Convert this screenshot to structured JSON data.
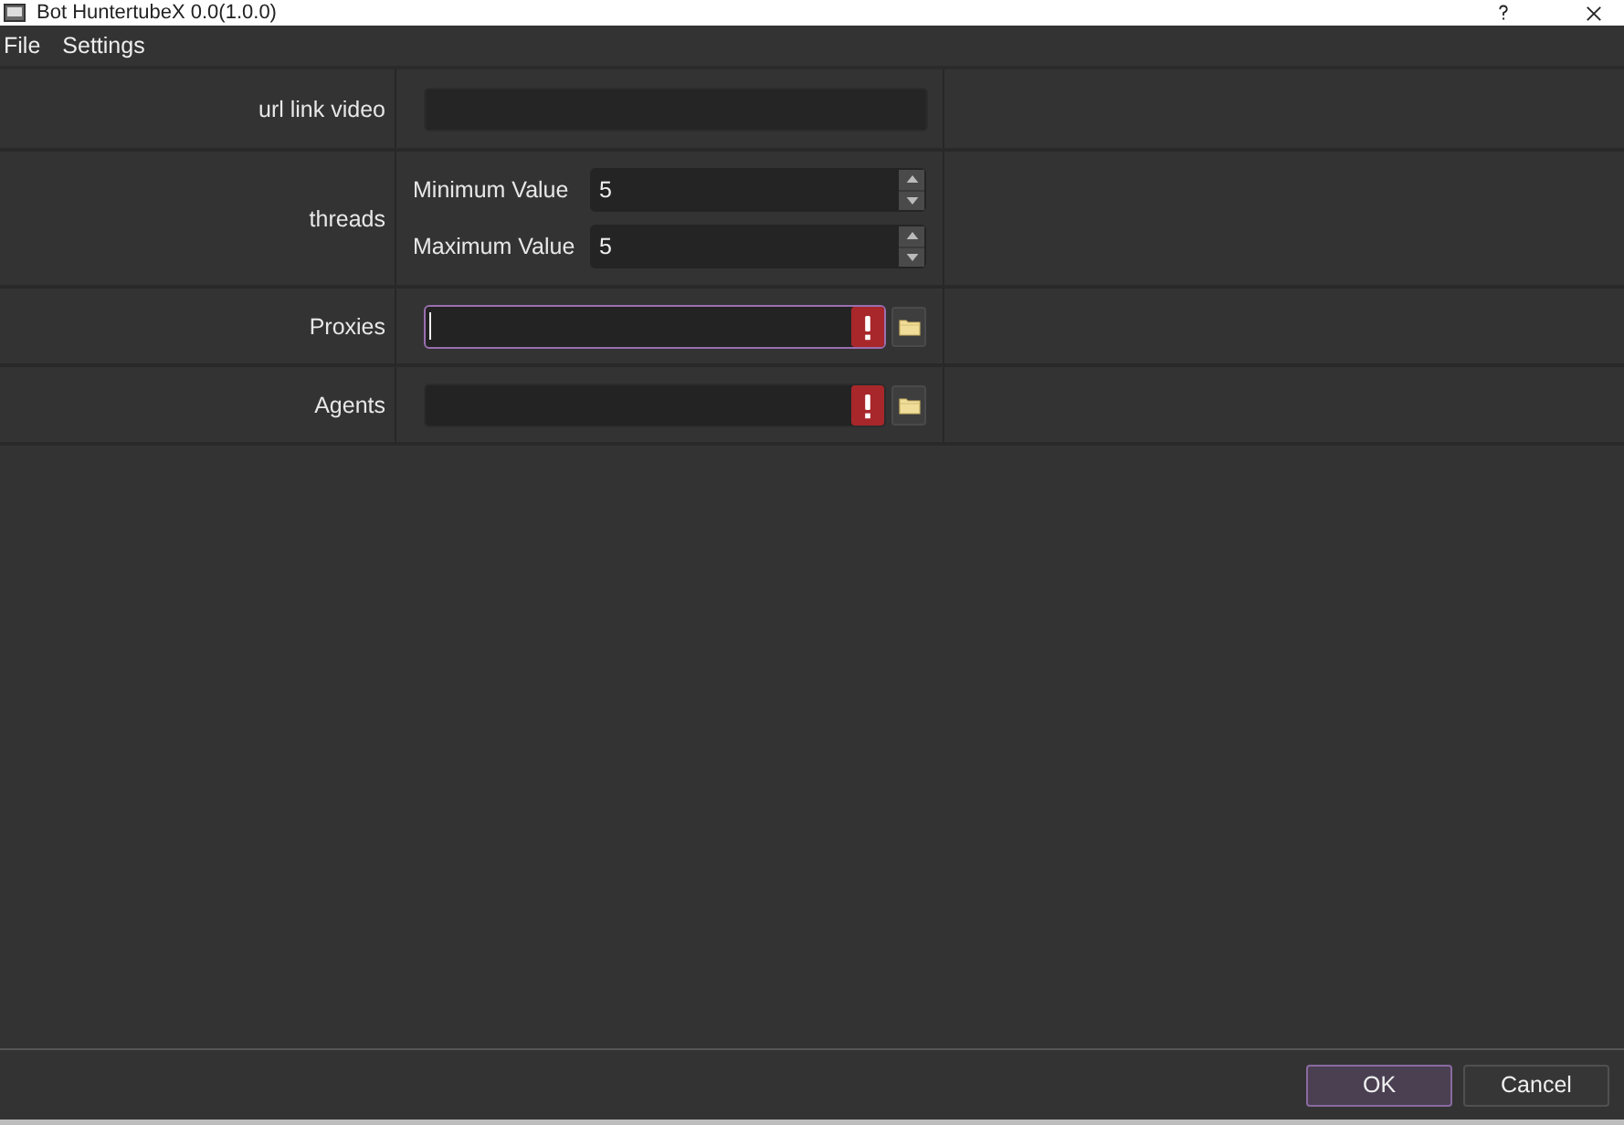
{
  "window": {
    "title": "Bot HuntertubeX 0.0(1.0.0)"
  },
  "menu": [
    {
      "label": "File"
    },
    {
      "label": "Settings"
    }
  ],
  "form": {
    "rows": [
      {
        "kind": "text",
        "label": "url link video"
      },
      {
        "kind": "spin_pair",
        "label": "threads",
        "fields": [
          {
            "label": "Minimum Value",
            "value": "5"
          },
          {
            "label": "Maximum Value",
            "value": "5"
          }
        ]
      },
      {
        "kind": "file",
        "label": "Proxies",
        "focused": true,
        "invalid": true
      },
      {
        "kind": "file",
        "label": "Agents",
        "focused": false,
        "invalid": true
      }
    ]
  },
  "buttons": [
    {
      "label": "OK",
      "default": true
    },
    {
      "label": "Cancel",
      "default": false
    }
  ]
}
